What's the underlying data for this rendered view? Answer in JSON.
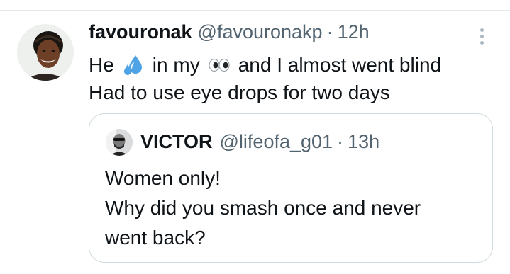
{
  "tweet": {
    "author": {
      "display_name": "favouronak",
      "handle": "@favouronakp",
      "separator": "·",
      "time": "12h",
      "avatar_icon": "user-avatar-photo"
    },
    "text": {
      "line1_before": "He",
      "emoji1": "sweat-droplets-icon",
      "line1_middle": "in my",
      "emoji2": "eyes-icon",
      "line1_after": "and I almost went blind",
      "line2": "Had to use eye drops for two days"
    },
    "more_icon": "more-options-icon"
  },
  "quoted_tweet": {
    "author": {
      "display_name": "VICTOR",
      "handle": "@lifeofa_g01",
      "separator": "·",
      "time": "13h",
      "avatar_icon": "user-avatar-photo"
    },
    "lines": [
      "Women only!",
      "Why did you smash once and never",
      "went back?"
    ]
  },
  "colors": {
    "text_primary": "#0f1419",
    "text_secondary": "#536471",
    "border": "#cfd9de",
    "emoji_droplets": "#4da3e6"
  }
}
